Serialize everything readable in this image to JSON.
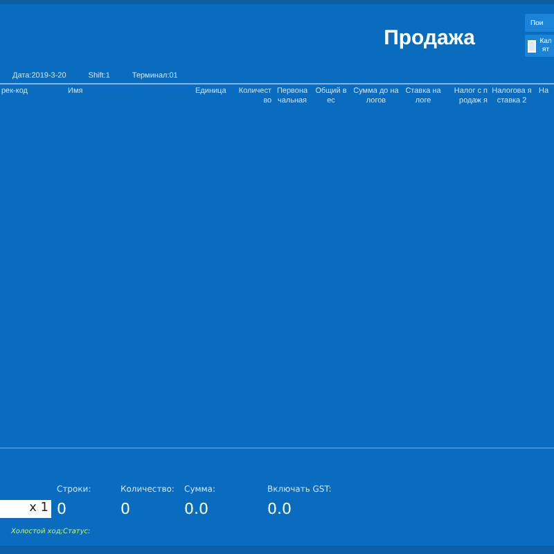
{
  "title": "Продажа",
  "buttons": [
    {
      "label": "Пои",
      "kind": "plain"
    },
    {
      "label": "Кал ят",
      "kind": "icon"
    }
  ],
  "info": [
    "Дата:2019-3-20",
    "Shift:1",
    "Терминал:01"
  ],
  "table": {
    "columns": [
      "рек-код",
      "Имя",
      "Единица",
      "Количест во",
      "Первона чальная",
      "Общий в ес",
      "Сумма до на логов",
      "Ставка на логе",
      "Налог с п родаж я",
      "Налогова я ставка 2",
      "На"
    ]
  },
  "quantity": {
    "value": "x 1"
  },
  "totals": [
    {
      "label": "Строки:",
      "value": "0"
    },
    {
      "label": "Количество:",
      "value": "0"
    },
    {
      "label": "Сумма:",
      "value": "0.0"
    },
    {
      "label": "Включать GST:",
      "value": "0.0"
    }
  ],
  "status": "Холостой ход;Статус:"
}
